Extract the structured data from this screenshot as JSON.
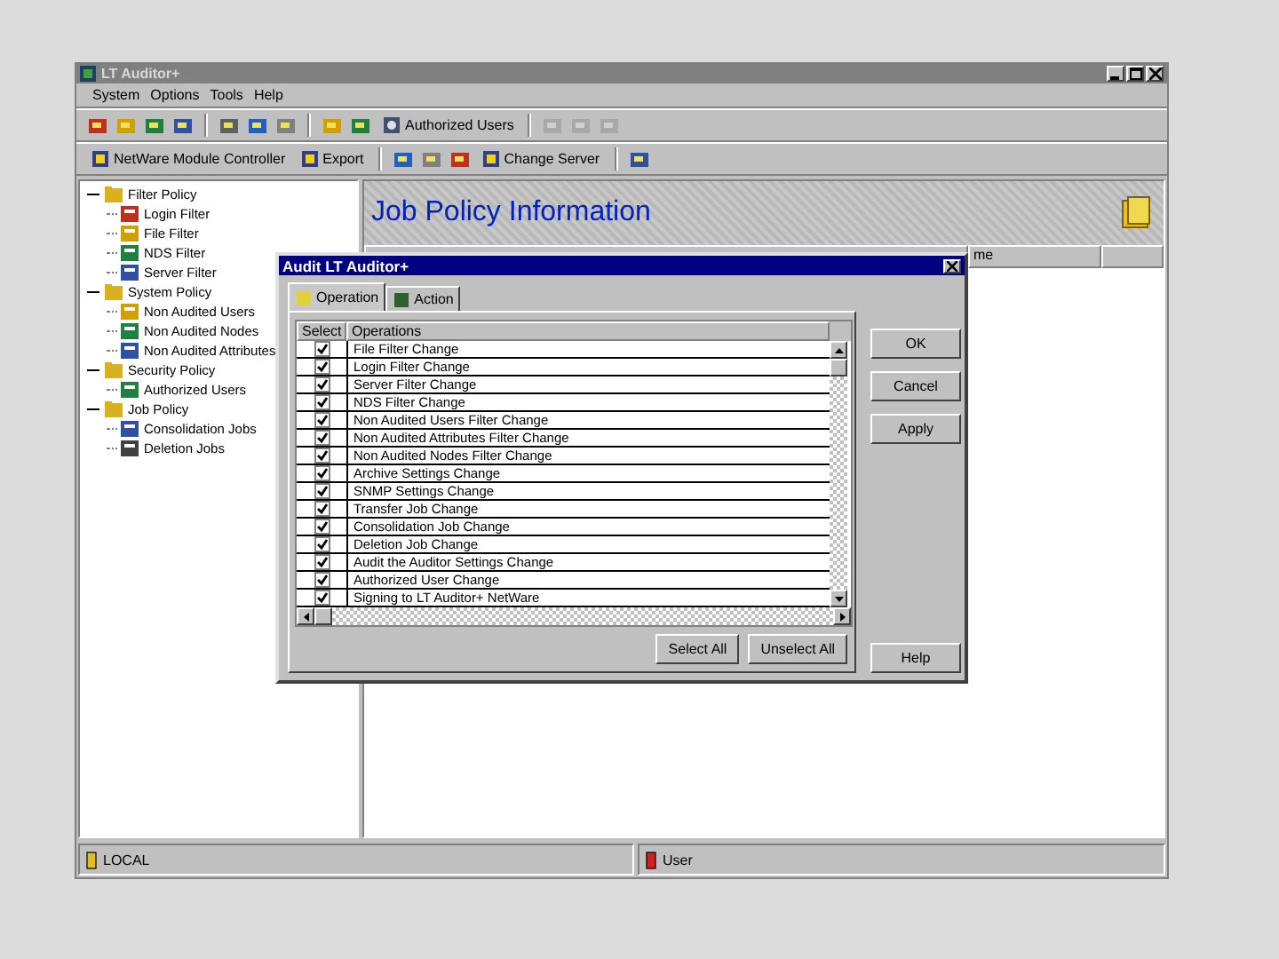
{
  "window": {
    "title": "LT Auditor+"
  },
  "menu": [
    "System",
    "Options",
    "Tools",
    "Help"
  ],
  "toolbar1": [
    {
      "kind": "icon",
      "disabled": false
    },
    {
      "kind": "icon",
      "disabled": false
    },
    {
      "kind": "icon",
      "disabled": false
    },
    {
      "kind": "icon",
      "disabled": false
    },
    {
      "kind": "sep"
    },
    {
      "kind": "icon",
      "disabled": false
    },
    {
      "kind": "icon",
      "disabled": false
    },
    {
      "kind": "icon",
      "disabled": false
    },
    {
      "kind": "sep"
    },
    {
      "kind": "icon",
      "disabled": false
    },
    {
      "kind": "icon",
      "disabled": false
    },
    {
      "kind": "text",
      "label": "Authorized Users",
      "disabled": false
    },
    {
      "kind": "sep"
    },
    {
      "kind": "icon",
      "disabled": true
    },
    {
      "kind": "icon",
      "disabled": true
    },
    {
      "kind": "icon",
      "disabled": true
    }
  ],
  "toolbar2": [
    {
      "kind": "text",
      "label": "NetWare Module Controller",
      "disabled": false
    },
    {
      "kind": "text",
      "label": "Export",
      "disabled": false
    },
    {
      "kind": "sep"
    },
    {
      "kind": "icon",
      "disabled": false
    },
    {
      "kind": "icon",
      "disabled": false
    },
    {
      "kind": "icon",
      "disabled": false
    },
    {
      "kind": "text",
      "label": "Change Server",
      "disabled": false
    },
    {
      "kind": "sep"
    },
    {
      "kind": "icon",
      "disabled": false
    }
  ],
  "tree": [
    {
      "label": "Filter Policy",
      "expanded": true,
      "children": [
        {
          "label": "Login Filter"
        },
        {
          "label": "File Filter"
        },
        {
          "label": "NDS Filter"
        },
        {
          "label": "Server Filter"
        }
      ]
    },
    {
      "label": "System Policy",
      "expanded": true,
      "children": [
        {
          "label": "Non Audited Users"
        },
        {
          "label": "Non Audited Nodes"
        },
        {
          "label": "Non Audited Attributes"
        }
      ]
    },
    {
      "label": "Security Policy",
      "expanded": true,
      "children": [
        {
          "label": "Authorized Users"
        }
      ]
    },
    {
      "label": "Job Policy",
      "expanded": true,
      "children": [
        {
          "label": "Consolidation Jobs"
        },
        {
          "label": "Deletion Jobs"
        }
      ]
    }
  ],
  "pane": {
    "heading": "Job Policy Information",
    "columns": [
      "",
      "me",
      ""
    ]
  },
  "dialog": {
    "title": "Audit LT Auditor+",
    "tabs": [
      {
        "label": "Operation",
        "selected": true
      },
      {
        "label": "Action",
        "selected": false
      }
    ],
    "columns": [
      "Select",
      "Operations"
    ],
    "rows": [
      {
        "operation": "File Filter Change",
        "checked": true
      },
      {
        "operation": "Login Filter Change",
        "checked": true
      },
      {
        "operation": "Server Filter Change",
        "checked": true
      },
      {
        "operation": "NDS Filter Change",
        "checked": true
      },
      {
        "operation": "Non Audited Users Filter Change",
        "checked": true
      },
      {
        "operation": "Non Audited Attributes Filter Change",
        "checked": true
      },
      {
        "operation": "Non Audited Nodes Filter Change",
        "checked": true
      },
      {
        "operation": "Archive Settings Change",
        "checked": true
      },
      {
        "operation": "SNMP Settings Change",
        "checked": true
      },
      {
        "operation": "Transfer Job Change",
        "checked": true
      },
      {
        "operation": "Consolidation Job Change",
        "checked": true
      },
      {
        "operation": "Deletion Job Change",
        "checked": true
      },
      {
        "operation": "Audit the Auditor Settings Change",
        "checked": true
      },
      {
        "operation": "Authorized User Change",
        "checked": true
      },
      {
        "operation": "Signing to LT Auditor+ NetWare",
        "checked": true
      }
    ],
    "list_buttons": [
      "Select All",
      "Unselect All"
    ],
    "side_buttons": [
      "OK",
      "Cancel",
      "Apply"
    ],
    "help_button": "Help"
  },
  "status_bar": [
    "LOCAL",
    "User"
  ]
}
